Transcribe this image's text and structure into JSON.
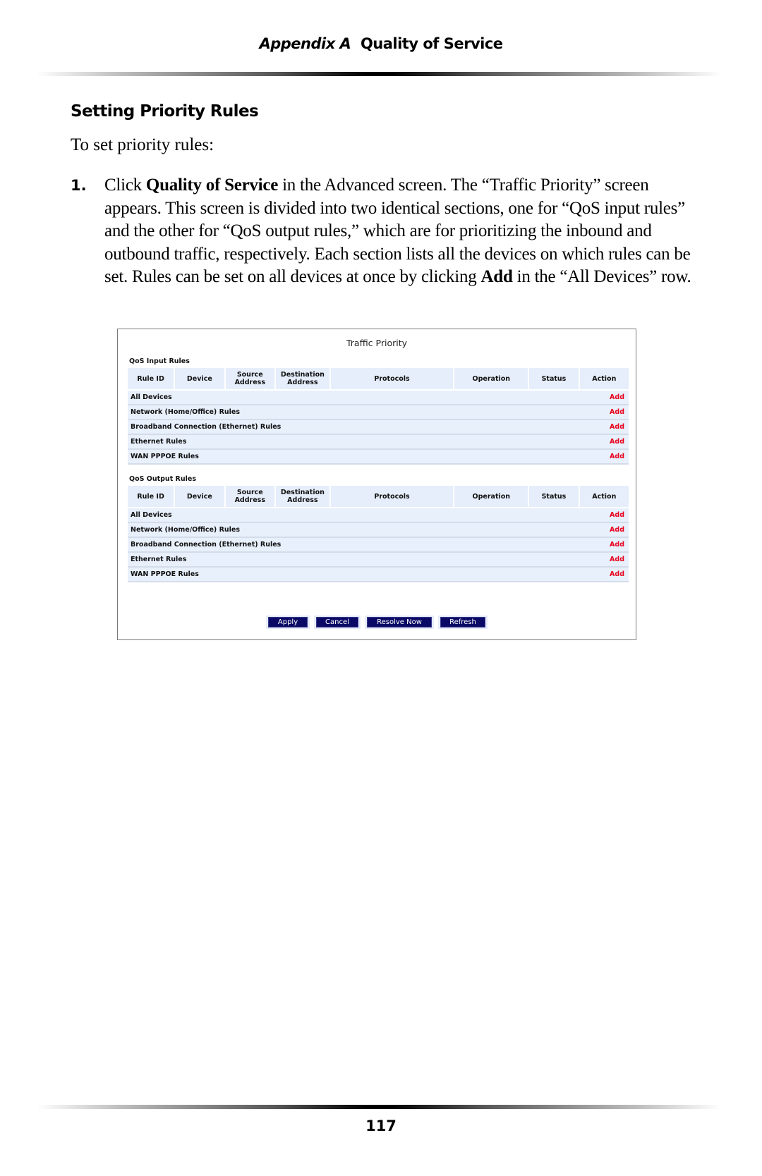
{
  "header": {
    "appendix_label": "Appendix A",
    "chapter_title": "Quality of Service"
  },
  "section_title": "Setting Priority Rules",
  "intro": "To set priority rules:",
  "steps": [
    {
      "number": "1.",
      "parts": [
        {
          "text": "Click ",
          "bold": false
        },
        {
          "text": "Quality of Service",
          "bold": true
        },
        {
          "text": " in the Advanced screen. The “Traffic Priority” screen appears. This screen is divided into two identical sections, one for “QoS input rules” and the other for “QoS output rules,” which are for prioritizing the inbound and outbound traffic, respectively. Each section lists all the devices on which rules can be set. Rules can be set on all devices at once by clicking ",
          "bold": false
        },
        {
          "text": "Add",
          "bold": true
        },
        {
          "text": " in the “All Devices” row.",
          "bold": false
        }
      ]
    }
  ],
  "screenshot": {
    "title": "Traffic Priority",
    "columns": [
      {
        "label": "Rule ID"
      },
      {
        "label": "Device"
      },
      {
        "label": "Source Address"
      },
      {
        "label": "Destination Address"
      },
      {
        "label": "Protocols"
      },
      {
        "label": "Operation"
      },
      {
        "label": "Status"
      },
      {
        "label": "Action"
      }
    ],
    "sections": [
      {
        "label": "QoS Input Rules",
        "rows": [
          {
            "name": "All Devices",
            "action": "Add"
          },
          {
            "name": "Network (Home/Office) Rules",
            "action": "Add"
          },
          {
            "name": "Broadband Connection (Ethernet) Rules",
            "action": "Add"
          },
          {
            "name": "Ethernet Rules",
            "action": "Add"
          },
          {
            "name": "WAN PPPOE Rules",
            "action": "Add"
          }
        ]
      },
      {
        "label": "QoS Output Rules",
        "rows": [
          {
            "name": "All Devices",
            "action": "Add"
          },
          {
            "name": "Network (Home/Office) Rules",
            "action": "Add"
          },
          {
            "name": "Broadband Connection (Ethernet) Rules",
            "action": "Add"
          },
          {
            "name": "Ethernet Rules",
            "action": "Add"
          },
          {
            "name": "WAN PPPOE Rules",
            "action": "Add"
          }
        ]
      }
    ],
    "buttons": {
      "apply": "Apply",
      "cancel": "Cancel",
      "resolve_now": "Resolve Now",
      "refresh": "Refresh"
    },
    "colors": {
      "header_bg": "#e6eefb",
      "row_bg": "#e8f0fc",
      "add_link": "#e8001c",
      "button_bg": "#0a0a66"
    }
  },
  "page_number": "117"
}
